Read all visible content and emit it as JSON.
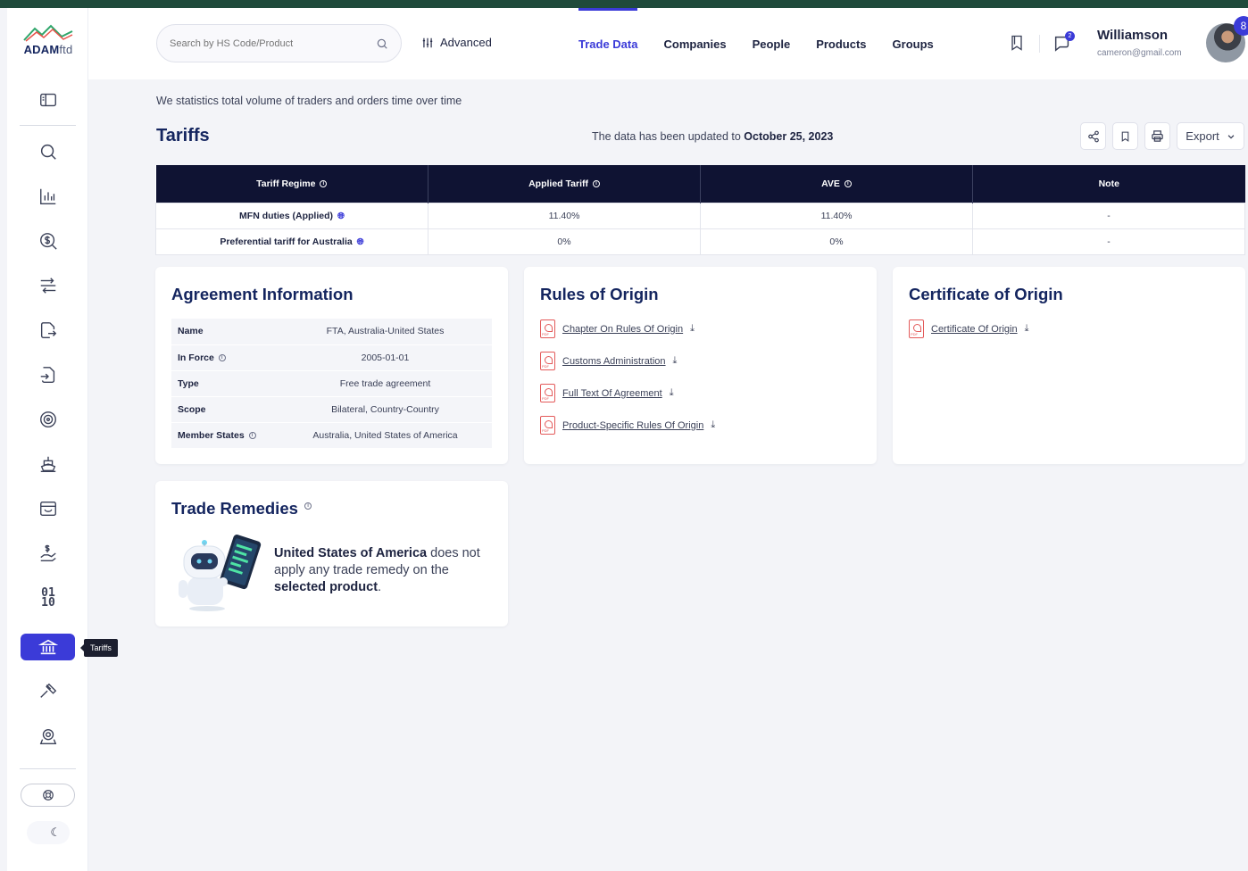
{
  "app": {
    "logo_brand": "ADAM",
    "logo_suffix": "ftd"
  },
  "sidebar": {
    "tooltip": "Tariffs",
    "icons": [
      "panel-icon",
      "search-icon",
      "bar-chart-icon",
      "dollar-search-icon",
      "transfer-icon",
      "file-export-icon",
      "file-import-icon",
      "target-icon",
      "ship-icon",
      "store-icon",
      "hand-dollar-icon",
      "binary-icon",
      "bank-icon",
      "gavel-icon",
      "location-icon",
      "lifebuoy-icon",
      "moon-icon"
    ],
    "binary_label": "01\n10"
  },
  "header": {
    "search_placeholder": "Search by HS Code/Product",
    "advanced_label": "Advanced",
    "nav": [
      "Trade Data",
      "Companies",
      "People",
      "Products",
      "Groups"
    ],
    "active_nav": "Trade Data",
    "chat_badge": "2",
    "user_name": "Williamson",
    "user_email": "cameron@gmail.com",
    "notif_count": "8"
  },
  "page": {
    "subtitle": "We statistics total volume of traders and orders time over time",
    "title": "Tariffs",
    "updated_prefix": "The data has been updated to",
    "updated_date": "October 25, 2023",
    "export_label": "Export"
  },
  "tariffs": {
    "headers": [
      "Tariff Regime",
      "Applied Tariff",
      "AVE",
      "Note"
    ],
    "rows": [
      {
        "regime": "MFN duties (Applied)",
        "applied": "11.40%",
        "ave": "11.40%",
        "note": "-"
      },
      {
        "regime": "Preferential tariff for Australia",
        "applied": "0%",
        "ave": "0%",
        "note": "-"
      }
    ]
  },
  "agreement": {
    "title": "Agreement Information",
    "rows": [
      {
        "key": "Name",
        "value": "FTA, Australia-United States"
      },
      {
        "key": "In Force",
        "value": "2005-01-01"
      },
      {
        "key": "Type",
        "value": "Free trade agreement"
      },
      {
        "key": "Scope",
        "value": "Bilateral, Country-Country"
      },
      {
        "key": "Member States",
        "value": "Australia, United States of America"
      }
    ]
  },
  "rules": {
    "title": "Rules of Origin",
    "docs": [
      "Chapter On Rules Of Origin",
      "Customs Administration",
      "Full Text Of Agreement",
      "Product-Specific Rules Of Origin"
    ]
  },
  "certificate": {
    "title": "Certificate of Origin",
    "docs": [
      "Certificate Of Origin"
    ]
  },
  "remedies": {
    "title": "Trade Remedies",
    "country": "United States of America",
    "middle": "does not apply any trade remedy on the",
    "product": "selected product",
    "end": "."
  },
  "colors": {
    "accent": "#3b3bd8",
    "navy": "#14255f",
    "table_header": "#0f1333",
    "pdf_red": "#e35a5a"
  }
}
